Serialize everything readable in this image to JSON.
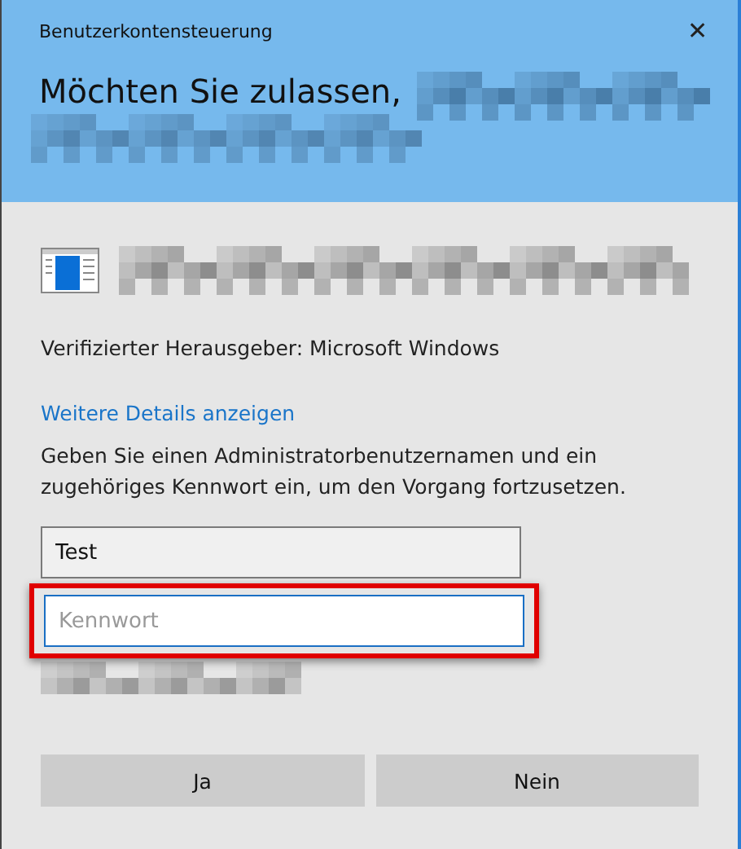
{
  "window": {
    "title": "Benutzerkontensteuerung",
    "close_glyph": "✕"
  },
  "headline": "Möchten Sie zulassen,",
  "publisher": "Verifizierter Herausgeber: Microsoft Windows",
  "details_link": "Weitere Details anzeigen",
  "instructions": "Geben Sie einen Administratorbenutzernamen und ein zugehöriges Kennwort ein, um den Vorgang fortzusetzen.",
  "username": {
    "value": "Test"
  },
  "password": {
    "placeholder": "Kennwort",
    "highlighted": true
  },
  "buttons": [
    {
      "label": "Ja"
    },
    {
      "label": "Nein"
    }
  ]
}
